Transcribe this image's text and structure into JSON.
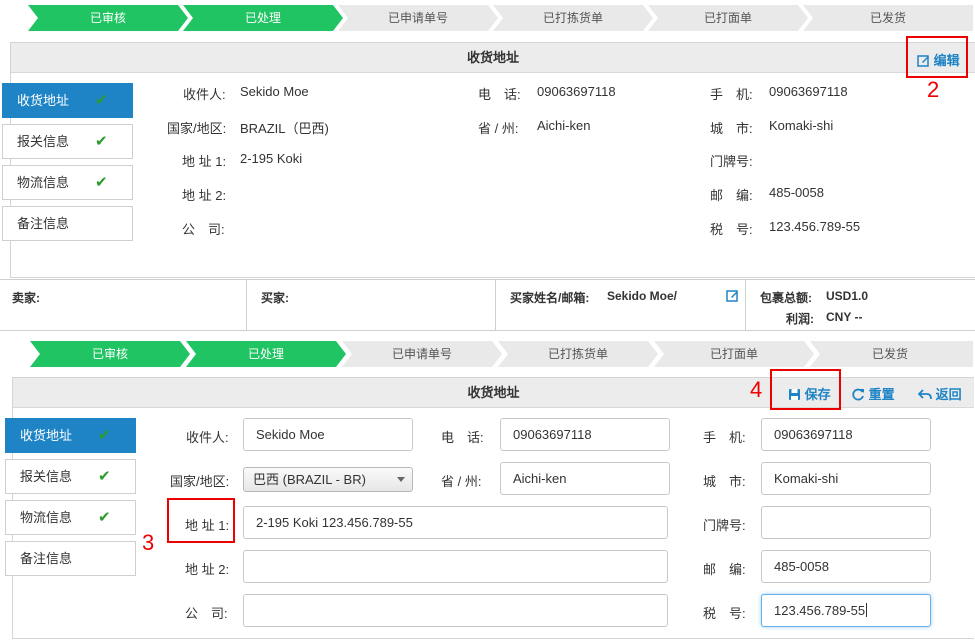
{
  "top": {
    "steps": [
      {
        "label": "已审核",
        "done": true
      },
      {
        "label": "已处理",
        "done": true
      },
      {
        "label": "已申请单号",
        "done": false
      },
      {
        "label": "已打拣货单",
        "done": false
      },
      {
        "label": "已打面单",
        "done": false
      },
      {
        "label": "已发货",
        "done": false
      }
    ],
    "panel_title": "收货地址",
    "edit_label": "编辑",
    "annotation": "2",
    "side_items": [
      {
        "label": "收货地址",
        "active": true,
        "checked": true
      },
      {
        "label": "报关信息",
        "active": false,
        "checked": true
      },
      {
        "label": "物流信息",
        "active": false,
        "checked": true
      },
      {
        "label": "备注信息",
        "active": false,
        "checked": false
      }
    ],
    "fields": {
      "recipient_label": "收件人:",
      "recipient": "Sekido Moe",
      "phone_label": "电　话:",
      "phone": "09063697118",
      "mobile_label": "手　机:",
      "mobile": "09063697118",
      "country_label": "国家/地区:",
      "country": "BRAZIL（巴西)",
      "province_label": "省 / 州:",
      "province": "Aichi-ken",
      "city_label": "城　市:",
      "city": "Komaki-shi",
      "address1_label": "地 址 1:",
      "address1": "2-195 Koki",
      "house_label": "门牌号:",
      "house": "",
      "address2_label": "地 址 2:",
      "address2": "",
      "zip_label": "邮　编:",
      "zip": "485-0058",
      "company_label": "公　司:",
      "company": "",
      "tax_label": "税　号:",
      "tax": "123.456.789-55"
    }
  },
  "info_bar": {
    "seller_label": "卖家:",
    "buyer_label": "买家:",
    "buyer_name_label": "买家姓名/邮箱:",
    "buyer_name": "Sekido Moe/",
    "total_label": "包裹总额:",
    "total": "USD1.0",
    "profit_label": "利润:",
    "profit": "CNY --"
  },
  "bottom": {
    "steps": [
      {
        "label": "已审核",
        "done": true
      },
      {
        "label": "已处理",
        "done": true
      },
      {
        "label": "已申请单号",
        "done": false
      },
      {
        "label": "已打拣货单",
        "done": false
      },
      {
        "label": "已打面单",
        "done": false
      },
      {
        "label": "已发货",
        "done": false
      }
    ],
    "panel_title": "收货地址",
    "save_label": "保存",
    "reset_label": "重置",
    "back_label": "返回",
    "annotation_save": "4",
    "annotation_address": "3",
    "side_items": [
      {
        "label": "收货地址",
        "active": true,
        "checked": true
      },
      {
        "label": "报关信息",
        "active": false,
        "checked": true
      },
      {
        "label": "物流信息",
        "active": false,
        "checked": true
      },
      {
        "label": "备注信息",
        "active": false,
        "checked": false
      }
    ],
    "form": {
      "recipient_label": "收件人:",
      "recipient": "Sekido Moe",
      "phone_label": "电　话:",
      "phone": "09063697118",
      "mobile_label": "手　机:",
      "mobile": "09063697118",
      "country_label": "国家/地区:",
      "country_selected": "巴西  (BRAZIL - BR)",
      "province_label": "省 / 州:",
      "province": "Aichi-ken",
      "city_label": "城　市:",
      "city": "Komaki-shi",
      "address1_label": "地 址 1:",
      "address1": "2-195 Koki 123.456.789-55",
      "house_label": "门牌号:",
      "house": "",
      "address2_label": "地 址 2:",
      "address2": "",
      "zip_label": "邮　编:",
      "zip": "485-0058",
      "company_label": "公　司:",
      "company": "",
      "tax_label": "税　号:",
      "tax": "123.456.789-55"
    }
  },
  "colors": {
    "step_done": "#20c462",
    "step_todo": "#e9e9e9",
    "accent": "#1f84c6",
    "check": "#2a9b2a",
    "annotation": "#ee0000"
  }
}
